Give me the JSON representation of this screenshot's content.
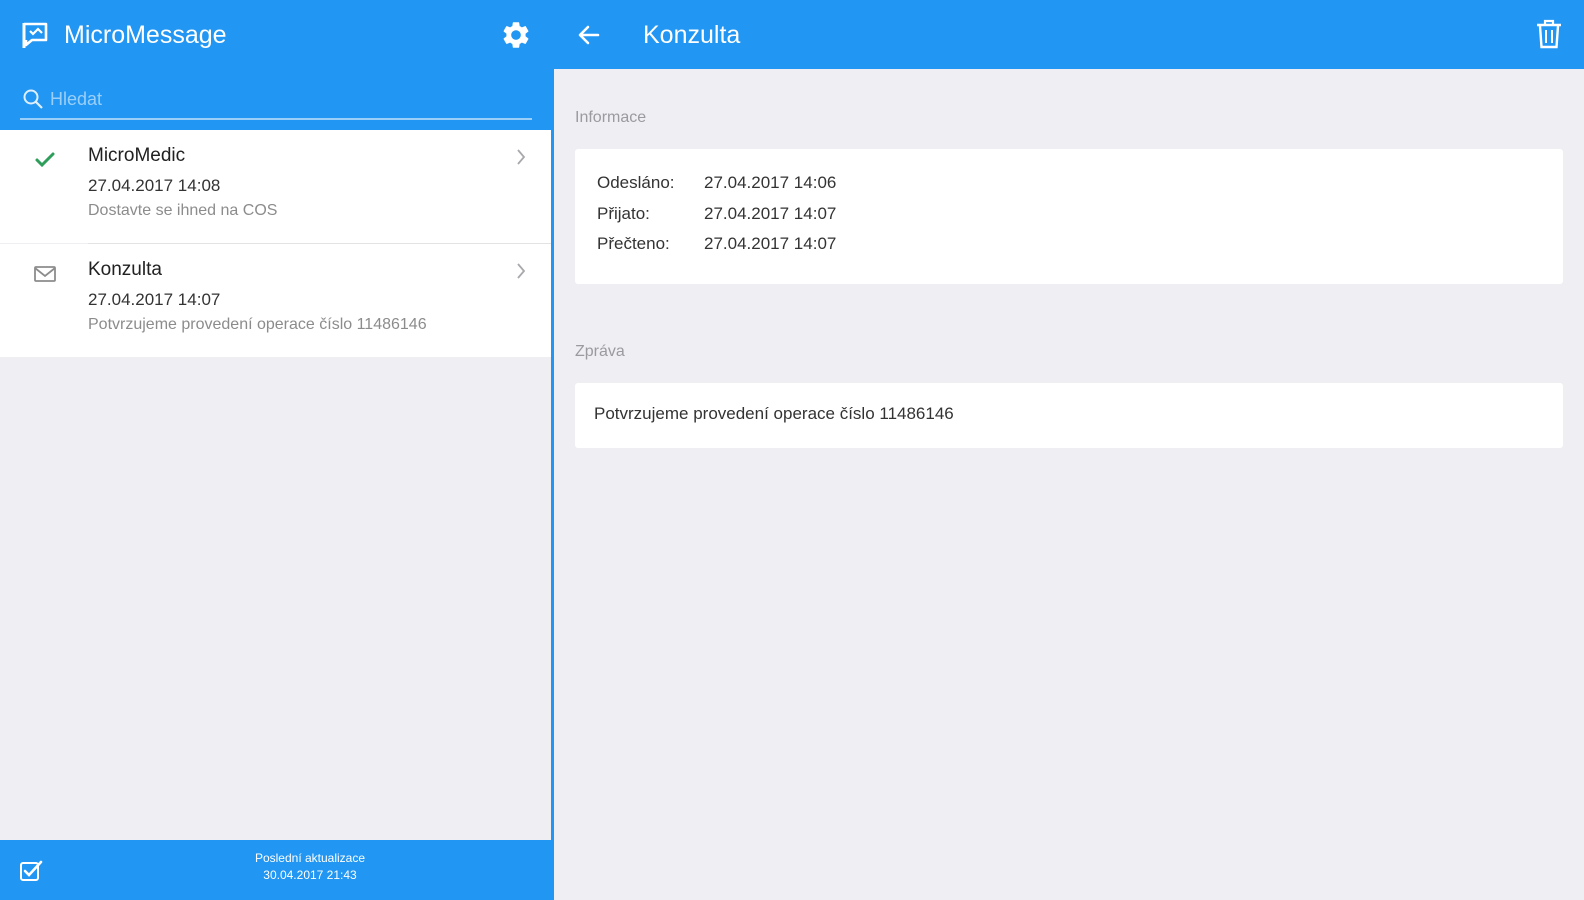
{
  "app": {
    "title": "MicroMessage",
    "accent_color": "#2196f3",
    "background_color": "#eeeef3",
    "icons": {
      "app": "chat-flag-icon",
      "settings": "gear-icon",
      "search": "search-icon"
    }
  },
  "search": {
    "placeholder": "Hledat",
    "value": ""
  },
  "messages": [
    {
      "name": "MicroMedic",
      "date": "27.04.2017 14:08",
      "preview": "Dostavte se ihned na COS",
      "status_icon": "checkmark-icon",
      "status_color": "#2e9e5b"
    },
    {
      "name": "Konzulta",
      "date": "27.04.2017 14:07",
      "preview": "Potvrzujeme provedení operace číslo 11486146",
      "status_icon": "envelope-icon",
      "status_color": "#8c8c8c"
    }
  ],
  "footer": {
    "line1": "Poslední aktualizace",
    "line2": "30.04.2017 21:43",
    "icon": "checkbox-checked-icon"
  },
  "detail": {
    "title": "Konzulta",
    "icons": {
      "back": "back-arrow-icon",
      "delete": "trash-icon"
    },
    "info_section_label": "Informace",
    "info": {
      "sent_label": "Odesláno:",
      "sent_value": "27.04.2017 14:06",
      "received_label": "Přijato:",
      "received_value": "27.04.2017 14:07",
      "read_label": "Přečteno:",
      "read_value": "27.04.2017 14:07"
    },
    "message_section_label": "Zpráva",
    "message_text": "Potvrzujeme provedení operace číslo 11486146"
  }
}
